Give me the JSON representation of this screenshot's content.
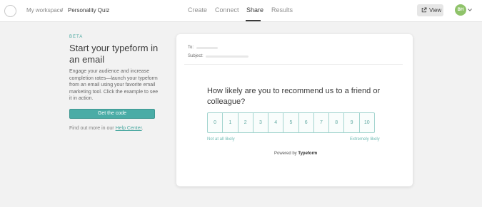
{
  "breadcrumb": {
    "workspace": "My workspace",
    "separator": "/",
    "current": "Personality Quiz"
  },
  "tabs": [
    {
      "label": "Create",
      "active": false
    },
    {
      "label": "Connect",
      "active": false
    },
    {
      "label": "Share",
      "active": true
    },
    {
      "label": "Results",
      "active": false
    }
  ],
  "header": {
    "view_label": "View",
    "view_icon": "external-link-icon",
    "avatar_initials": "BH",
    "avatar_color": "#8fc36a",
    "menu_icon": "chevron-down-icon"
  },
  "left_panel": {
    "badge": "BETA",
    "title": "Start your typeform in an email",
    "description": "Engage your audience and increase completion rates—launch your typeform from an email using your favorite email marketing tool. Click the example to see it in action.",
    "cta_label": "Get the code",
    "help_prefix": "Find out more in our ",
    "help_link": "Help Center",
    "help_suffix": "."
  },
  "email_preview": {
    "to_label": "To:",
    "subject_label": "Subject:",
    "question": "How likely are you to recommend us to a friend or colleague?",
    "scale": [
      "0",
      "1",
      "2",
      "3",
      "4",
      "5",
      "6",
      "7",
      "8",
      "9",
      "10"
    ],
    "scale_min_label": "Not at all likely",
    "scale_max_label": "Extremely likely",
    "powered_prefix": "Powered by ",
    "powered_brand": "Typeform"
  },
  "colors": {
    "accent": "#4aaca6",
    "background": "#f2f2f2",
    "card": "#ffffff"
  }
}
